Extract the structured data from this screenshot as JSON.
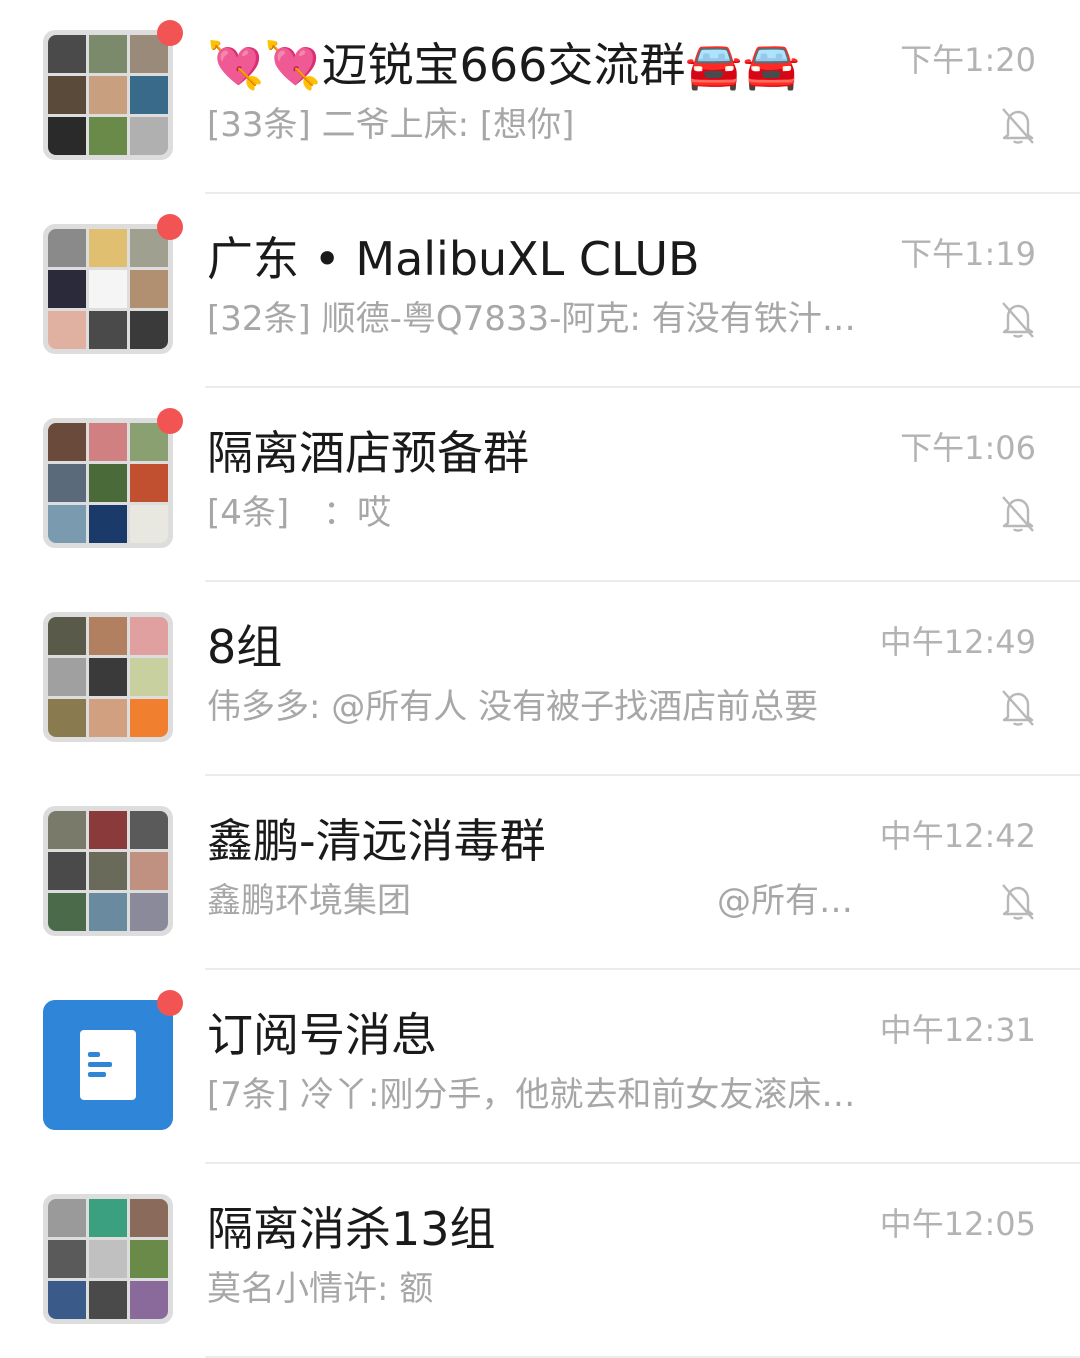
{
  "chats": [
    {
      "name": "💘💘迈锐宝666交流群🚘🚘",
      "preview": "[33条] 二爷上床: [想你]",
      "time": "下午1:20",
      "muted": true,
      "unread": true,
      "avatar_colors": [
        "#4a4a4a",
        "#7a8a6a",
        "#9a8a7a",
        "#5a4a3a",
        "#c8a080",
        "#3a6a8a",
        "#2a2a2a",
        "#6a8a4a",
        "#b0b0b0"
      ]
    },
    {
      "name": "广东 • MalibuXL CLUB",
      "preview": "[32条] 顺德-粤Q7833-阿克: 有没有铁汁…",
      "time": "下午1:19",
      "muted": true,
      "unread": true,
      "avatar_colors": [
        "#8a8a8a",
        "#e0c070",
        "#a0a090",
        "#2a2a3a",
        "#f5f5f5",
        "#b09070",
        "#e0b0a0",
        "#4a4a4a",
        "#3a3a3a"
      ]
    },
    {
      "name": "隔离酒店预备群",
      "preview": "[4条]　：哎",
      "time": "下午1:06",
      "muted": true,
      "unread": true,
      "avatar_colors": [
        "#6a4a3a",
        "#d08080",
        "#8aa070",
        "#5a6a7a",
        "#4a6a3a",
        "#c05030",
        "#7a9ab0",
        "#1a3a6a",
        "#e8e8e0"
      ]
    },
    {
      "name": "8组",
      "preview": "伟多多: @所有人 没有被子找酒店前总要",
      "time": "中午12:49",
      "muted": true,
      "unread": false,
      "avatar_colors": [
        "#5a5a4a",
        "#b08060",
        "#e0a0a0",
        "#a0a0a0",
        "#3a3a3a",
        "#c8d0a0",
        "#8a7a50",
        "#d0a080",
        "#f08030"
      ]
    },
    {
      "name": "鑫鹏-清远消毒群",
      "preview": "鑫鹏环境集团　　　　　　　　　@所有…",
      "time": "中午12:42",
      "muted": true,
      "unread": false,
      "avatar_colors": [
        "#7a7a6a",
        "#8a3a3a",
        "#5a5a5a",
        "#4a4a4a",
        "#6a6a5a",
        "#c09080",
        "#4a6a4a",
        "#6a8aa0",
        "#8a8a9a"
      ]
    },
    {
      "name": "订阅号消息",
      "preview": "[7条] 冷丫:刚分手，他就去和前女友滚床…",
      "time": "中午12:31",
      "muted": false,
      "unread": true,
      "avatar_colors": []
    },
    {
      "name": "隔离消杀13组",
      "preview": "莫名小情许: 额",
      "time": "中午12:05",
      "muted": false,
      "unread": false,
      "avatar_colors": [
        "#9a9a9a",
        "#3aa080",
        "#8a6a5a",
        "#5a5a5a",
        "#c0c0c0",
        "#6a8a4a",
        "#3a5a8a",
        "#4a4a4a",
        "#8a6a9a"
      ]
    }
  ]
}
